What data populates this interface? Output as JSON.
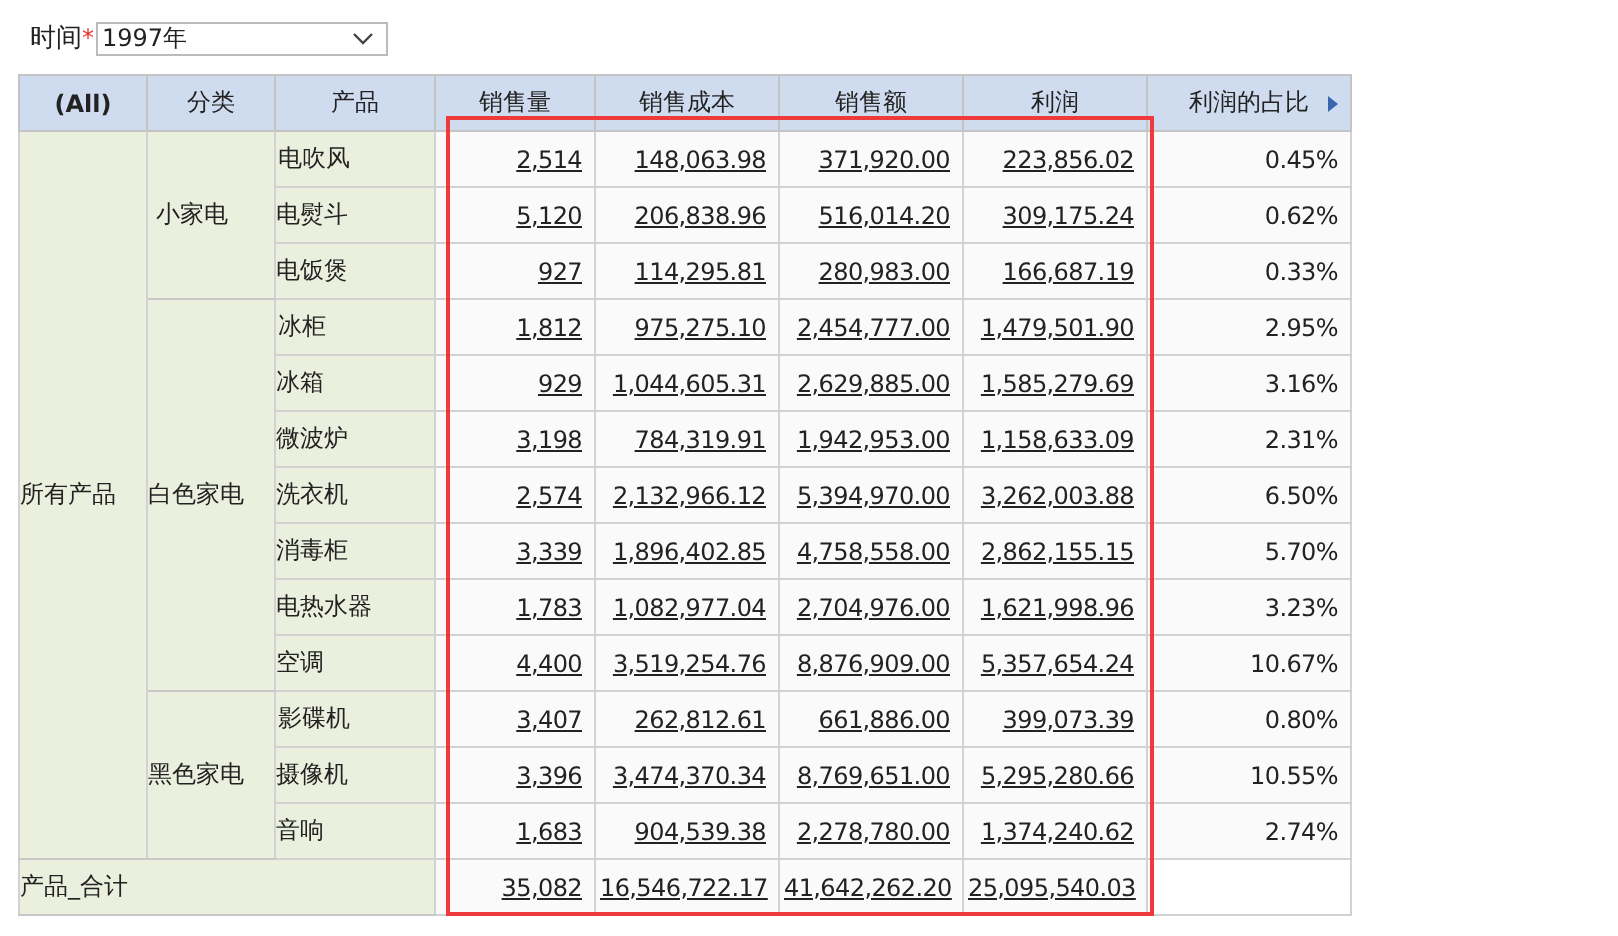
{
  "filter": {
    "label": "时间",
    "required_mark": "*",
    "value": "1997年"
  },
  "table": {
    "columns": [
      "(All)",
      "分类",
      "产品",
      "销售量",
      "销售成本",
      "销售额",
      "利润",
      "利润的占比"
    ],
    "groups": [
      {
        "label": "所有产品",
        "categories": [
          {
            "label": "小家电",
            "products": [
              {
                "name": "电吹风",
                "values": [
                  "2,514",
                  "148,063.98",
                  "371,920.00",
                  "223,856.02"
                ],
                "share": "0.45%"
              },
              {
                "name": "电熨斗",
                "values": [
                  "5,120",
                  "206,838.96",
                  "516,014.20",
                  "309,175.24"
                ],
                "share": "0.62%"
              },
              {
                "name": "电饭煲",
                "values": [
                  "927",
                  "114,295.81",
                  "280,983.00",
                  "166,687.19"
                ],
                "share": "0.33%"
              }
            ]
          },
          {
            "label": "白色家电",
            "products": [
              {
                "name": "冰柜",
                "values": [
                  "1,812",
                  "975,275.10",
                  "2,454,777.00",
                  "1,479,501.90"
                ],
                "share": "2.95%"
              },
              {
                "name": "冰箱",
                "values": [
                  "929",
                  "1,044,605.31",
                  "2,629,885.00",
                  "1,585,279.69"
                ],
                "share": "3.16%"
              },
              {
                "name": "微波炉",
                "values": [
                  "3,198",
                  "784,319.91",
                  "1,942,953.00",
                  "1,158,633.09"
                ],
                "share": "2.31%"
              },
              {
                "name": "洗衣机",
                "values": [
                  "2,574",
                  "2,132,966.12",
                  "5,394,970.00",
                  "3,262,003.88"
                ],
                "share": "6.50%"
              },
              {
                "name": "消毒柜",
                "values": [
                  "3,339",
                  "1,896,402.85",
                  "4,758,558.00",
                  "2,862,155.15"
                ],
                "share": "5.70%"
              },
              {
                "name": "电热水器",
                "values": [
                  "1,783",
                  "1,082,977.04",
                  "2,704,976.00",
                  "1,621,998.96"
                ],
                "share": "3.23%"
              },
              {
                "name": "空调",
                "values": [
                  "4,400",
                  "3,519,254.76",
                  "8,876,909.00",
                  "5,357,654.24"
                ],
                "share": "10.67%"
              }
            ]
          },
          {
            "label": "黑色家电",
            "products": [
              {
                "name": "影碟机",
                "values": [
                  "3,407",
                  "262,812.61",
                  "661,886.00",
                  "399,073.39"
                ],
                "share": "0.80%"
              },
              {
                "name": "摄像机",
                "values": [
                  "3,396",
                  "3,474,370.34",
                  "8,769,651.00",
                  "5,295,280.66"
                ],
                "share": "10.55%"
              },
              {
                "name": "音响",
                "values": [
                  "1,683",
                  "904,539.38",
                  "2,278,780.00",
                  "1,374,240.62"
                ],
                "share": "2.74%"
              }
            ]
          }
        ]
      }
    ],
    "total": {
      "label": "产品_合计",
      "values": [
        "35,082",
        "16,546,722.17",
        "41,642,262.20",
        "25,095,540.03"
      ]
    }
  },
  "highlight_frame": true
}
